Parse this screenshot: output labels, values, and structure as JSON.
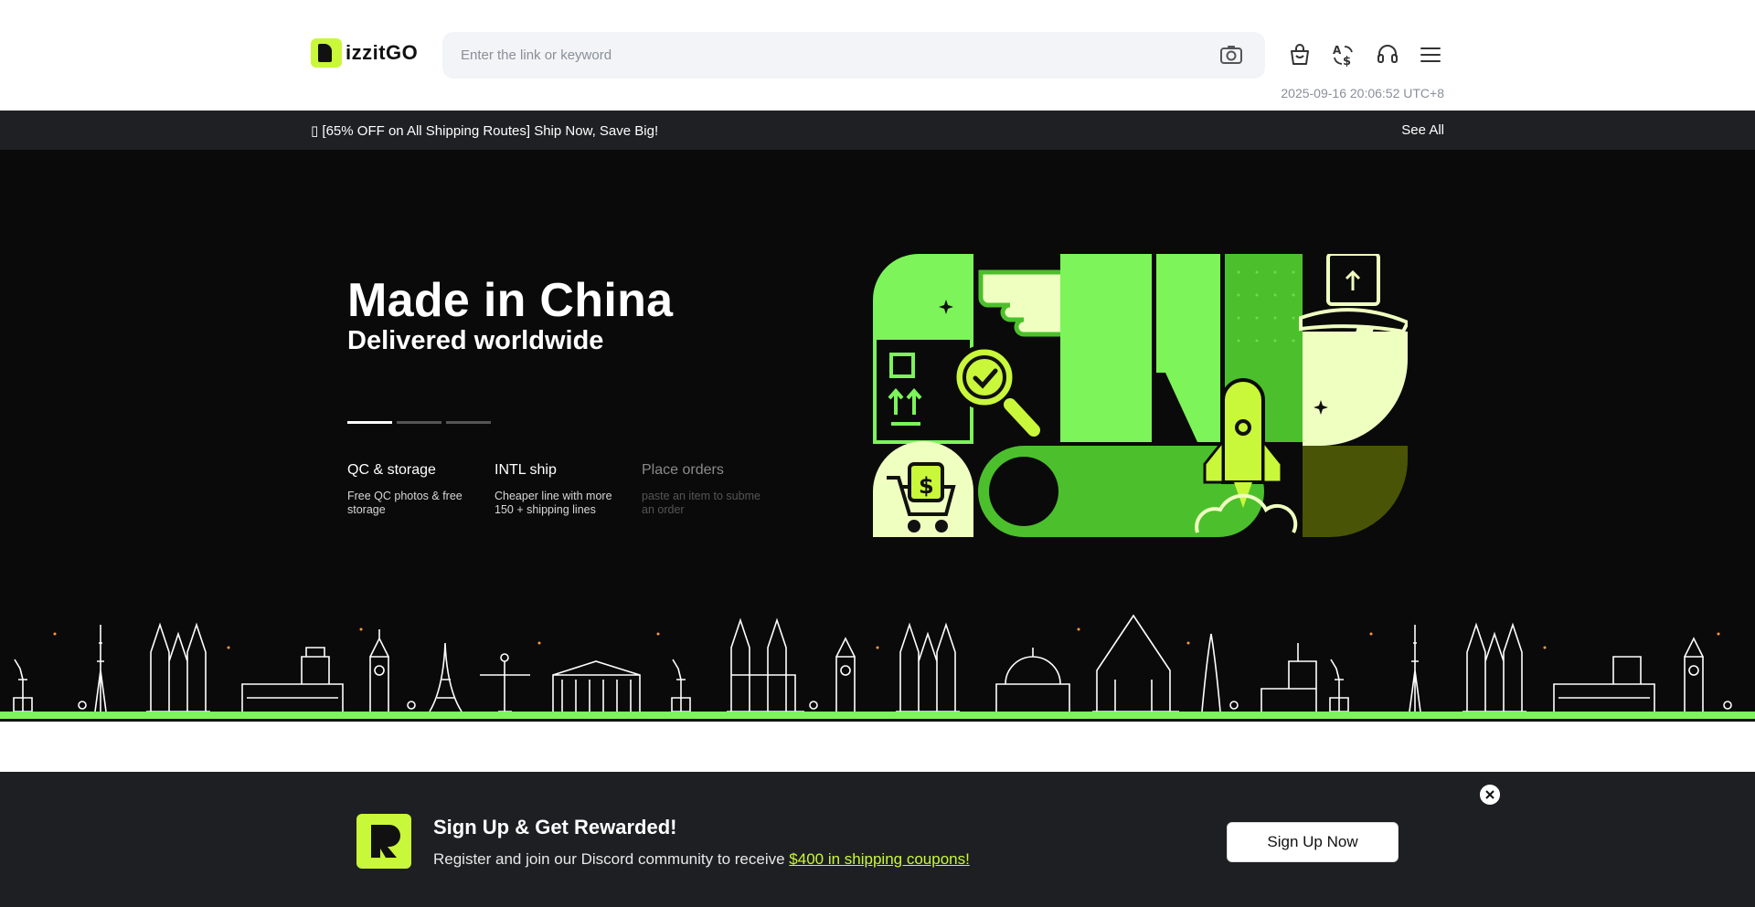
{
  "header": {
    "logo_text": "izzitGO",
    "search_placeholder": "Enter the link or keyword",
    "timestamp": "2025-09-16 20:06:52 UTC+8",
    "icons": [
      "camera-icon",
      "shopping-bag-icon",
      "currency-icon",
      "headset-icon",
      "menu-icon"
    ]
  },
  "promo": {
    "text": "▯ [65% OFF on All Shipping Routes] Ship Now, Save Big!",
    "see_all": "See All"
  },
  "hero": {
    "title": "Made in China",
    "subtitle": "Delivered worldwide",
    "slide_index": 1,
    "slide_count": 3,
    "features": [
      {
        "title": "QC & storage",
        "desc": "Free QC photos & free storage"
      },
      {
        "title": "INTL ship",
        "desc": "Cheaper line with more 150 + shipping lines"
      },
      {
        "title": "Place orders",
        "desc": "paste an item to subme an order"
      }
    ],
    "colors": {
      "lime": "#c9f73a",
      "green": "#7cf45a",
      "dark_green": "#4cc02c",
      "olive": "#4a5406",
      "cream": "#efffc0"
    }
  },
  "signup": {
    "title": "Sign Up & Get Rewarded!",
    "desc_prefix": "Register and join our Discord community to receive ",
    "desc_link": "$400 in shipping coupons!",
    "button": "Sign Up Now"
  }
}
